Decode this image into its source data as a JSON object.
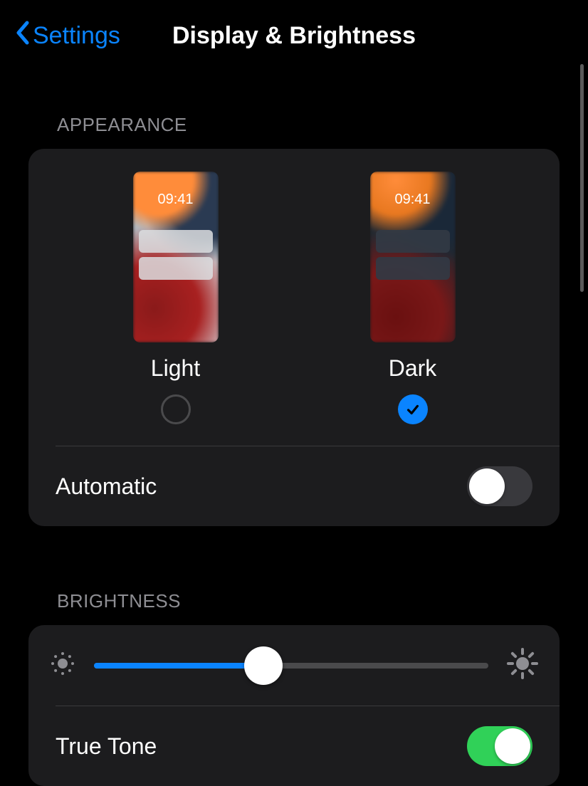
{
  "nav": {
    "back_label": "Settings",
    "title": "Display & Brightness"
  },
  "appearance": {
    "header": "APPEARANCE",
    "preview_time": "09:41",
    "options": {
      "light": {
        "label": "Light",
        "selected": false
      },
      "dark": {
        "label": "Dark",
        "selected": true
      }
    },
    "automatic": {
      "label": "Automatic",
      "enabled": false
    }
  },
  "brightness": {
    "header": "BRIGHTNESS",
    "value_percent": 43,
    "true_tone": {
      "label": "True Tone",
      "enabled": true
    }
  },
  "colors": {
    "accent": "#0a84ff",
    "toggle_on": "#30d158",
    "card": "#1c1c1e"
  }
}
